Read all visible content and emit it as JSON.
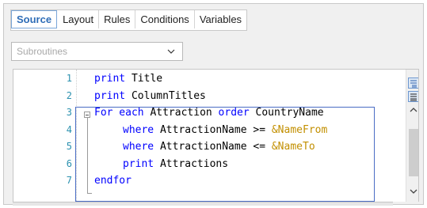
{
  "tabs": [
    {
      "label": "Source",
      "active": true
    },
    {
      "label": "Layout",
      "active": false
    },
    {
      "label": "Rules",
      "active": false
    },
    {
      "label": "Conditions",
      "active": false
    },
    {
      "label": "Variables",
      "active": false
    }
  ],
  "dropdown": {
    "value": "Subroutines"
  },
  "code": {
    "lines": [
      {
        "num": "1",
        "parts": [
          {
            "t": "print ",
            "c": "kw"
          },
          {
            "t": "Title",
            "c": "txt"
          }
        ]
      },
      {
        "num": "2",
        "parts": [
          {
            "t": "print ",
            "c": "kw"
          },
          {
            "t": "ColumnTitles",
            "c": "txt"
          }
        ]
      },
      {
        "num": "3",
        "parts": [
          {
            "t": "For each ",
            "c": "kw"
          },
          {
            "t": "Attraction ",
            "c": "txt"
          },
          {
            "t": "order ",
            "c": "kw"
          },
          {
            "t": "CountryName",
            "c": "txt"
          }
        ]
      },
      {
        "num": "4",
        "parts": [
          {
            "t": "where ",
            "c": "kw"
          },
          {
            "t": "AttractionName >= ",
            "c": "txt"
          },
          {
            "t": "&NameFrom",
            "c": "var"
          }
        ]
      },
      {
        "num": "5",
        "parts": [
          {
            "t": "where ",
            "c": "kw"
          },
          {
            "t": "AttractionName <= ",
            "c": "txt"
          },
          {
            "t": "&NameTo",
            "c": "var"
          }
        ]
      },
      {
        "num": "6",
        "parts": [
          {
            "t": "print ",
            "c": "kw"
          },
          {
            "t": "Attractions",
            "c": "txt"
          }
        ]
      },
      {
        "num": "7",
        "parts": [
          {
            "t": "endfor",
            "c": "kw"
          }
        ]
      }
    ]
  },
  "colors": {
    "active_tab": "#2e6db7",
    "keyword": "#0000ff",
    "variable": "#c28f00",
    "line_number": "#2b91af",
    "block_border": "#4a6cc4"
  },
  "icons": [
    "chevron-down-icon",
    "collapse-icon",
    "outline-icon",
    "scroll-up-icon",
    "scroll-down-icon"
  ]
}
